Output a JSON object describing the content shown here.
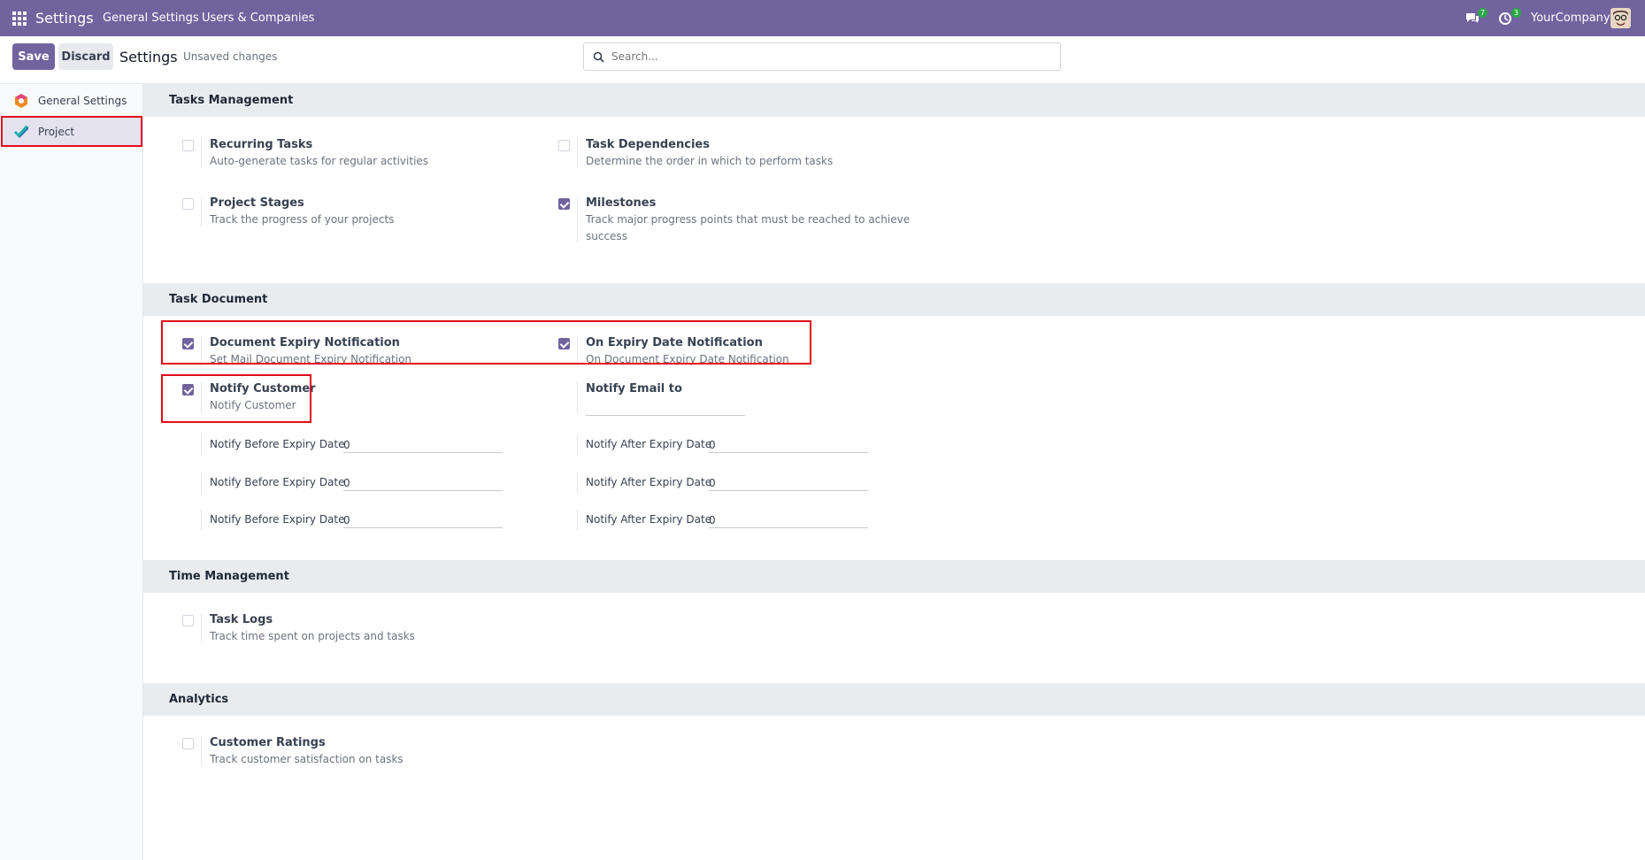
{
  "topbar": {
    "brand": "Settings",
    "menu": [
      "General Settings",
      "Users & Companies"
    ],
    "messages_count": "7",
    "activities_count": "3",
    "company": "YourCompany",
    "color": "#71639e"
  },
  "control": {
    "save_label": "Save",
    "discard_label": "Discard",
    "title": "Settings",
    "status": "Unsaved changes",
    "search_placeholder": "Search..."
  },
  "sidebar": {
    "items": [
      {
        "label": "General Settings",
        "icon": "settings-app-icon"
      },
      {
        "label": "Project",
        "icon": "project-app-icon",
        "active": true
      }
    ]
  },
  "sections": {
    "tasks_management": {
      "title": "Tasks Management",
      "recurring": {
        "title": "Recurring Tasks",
        "desc": "Auto-generate tasks for regular activities",
        "checked": false
      },
      "dependencies": {
        "title": "Task Dependencies",
        "desc": "Determine the order in which to perform tasks",
        "checked": false
      },
      "stages": {
        "title": "Project Stages",
        "desc": "Track the progress of your projects",
        "checked": false
      },
      "milestones": {
        "title": "Milestones",
        "desc": "Track major progress points that must be reached to achieve success",
        "checked": true
      }
    },
    "task_document": {
      "title": "Task Document",
      "expiry_notification": {
        "title": "Document Expiry Notification",
        "desc": "Set Mail Document Expiry Notification",
        "checked": true
      },
      "on_expiry": {
        "title": "On Expiry Date Notification",
        "desc": "On Document Expiry Date Notification",
        "checked": true
      },
      "notify_customer": {
        "title": "Notify Customer",
        "desc": "Notify Customer",
        "checked": true
      },
      "notify_email": {
        "title": "Notify Email to",
        "value": ""
      },
      "before_label": "Notify Before Expiry Date",
      "after_label": "Notify After Expiry Date",
      "before_values": [
        "0",
        "0",
        "0"
      ],
      "after_values": [
        "0",
        "0",
        "0"
      ]
    },
    "time_management": {
      "title": "Time Management",
      "task_logs": {
        "title": "Task Logs",
        "desc": "Track time spent on projects and tasks",
        "checked": false
      }
    },
    "analytics": {
      "title": "Analytics",
      "ratings": {
        "title": "Customer Ratings",
        "desc": "Track customer satisfaction on tasks",
        "checked": false
      }
    }
  }
}
